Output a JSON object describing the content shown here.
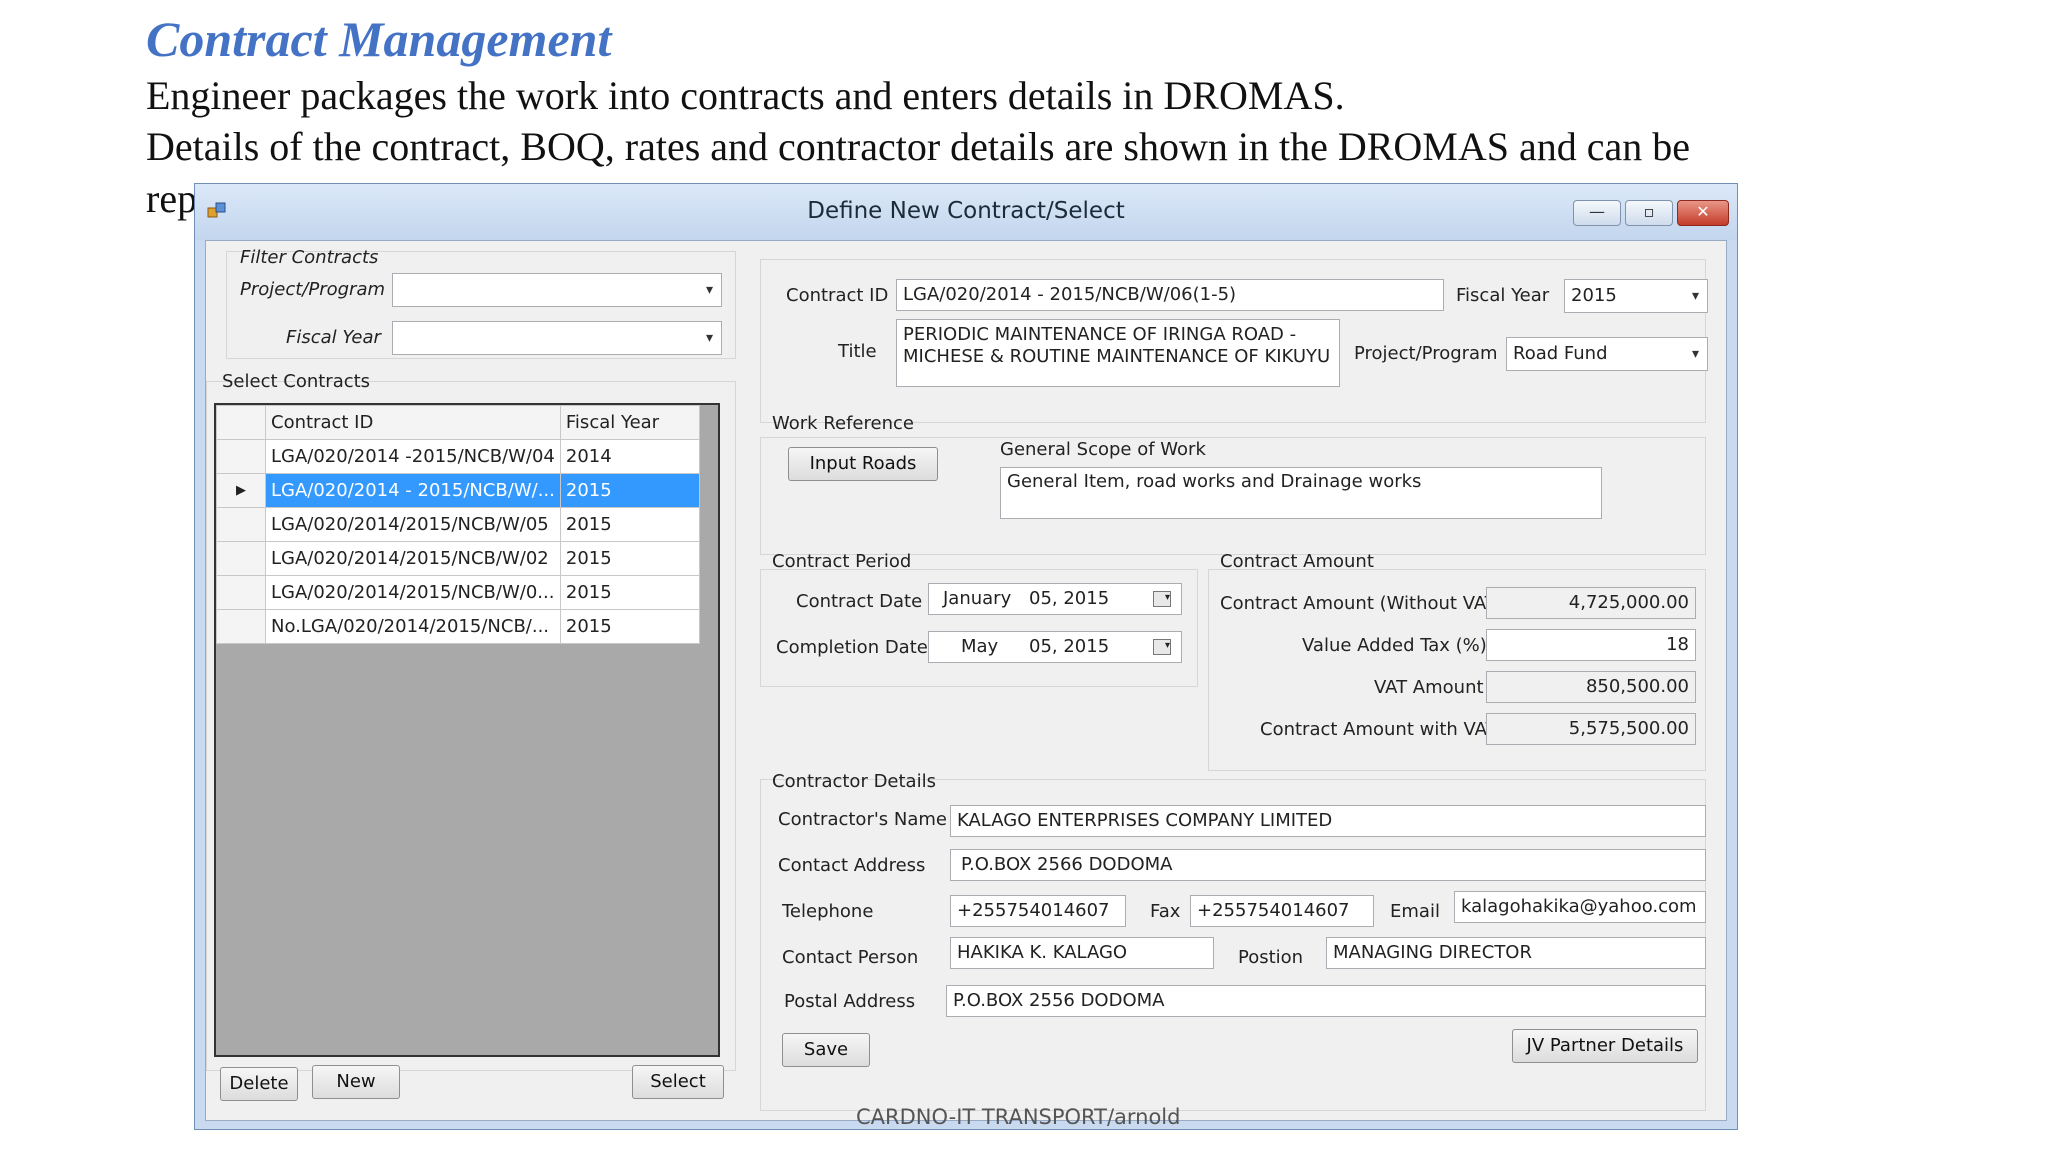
{
  "slide": {
    "title": "Contract Management",
    "line1": "Engineer packages the work into contracts and enters details in DROMAS.",
    "line2": "Details of the contract, BOQ, rates and contractor details are shown in the DROMAS and can be",
    "line3": "rep"
  },
  "window": {
    "title": "Define New Contract/Select",
    "controls": {
      "minimize": "—",
      "maximize": "▫",
      "close": "✕"
    }
  },
  "filter": {
    "group_label": "Filter Contracts",
    "project_label": "Project/Program",
    "project_value": "",
    "fiscal_label": "Fiscal Year",
    "fiscal_value": ""
  },
  "select_contracts": {
    "label": "Select Contracts",
    "columns": [
      "Contract ID",
      "Fiscal Year"
    ],
    "rows": [
      {
        "id": "LGA/020/2014 -2015/NCB/W/04",
        "year": "2014"
      },
      {
        "id": "LGA/020/2014 - 2015/NCB/W/...",
        "year": "2015"
      },
      {
        "id": "LGA/020/2014/2015/NCB/W/05",
        "year": "2015"
      },
      {
        "id": "LGA/020/2014/2015/NCB/W/02",
        "year": "2015"
      },
      {
        "id": "LGA/020/2014/2015/NCB/W/0...",
        "year": "2015"
      },
      {
        "id": "No.LGA/020/2014/2015/NCB/...",
        "year": "2015"
      }
    ],
    "selected_row_marker": "▶",
    "buttons": {
      "delete": "Delete",
      "new": "New",
      "select": "Select"
    }
  },
  "contract": {
    "id_label": "Contract ID",
    "id_value": "LGA/020/2014 - 2015/NCB/W/06(1-5)",
    "fiscal_label": "Fiscal Year",
    "fiscal_value": "2015",
    "title_label": "Title",
    "title_value": "PERIODIC MAINTENANCE OF IRINGA ROAD - MICHESE & ROUTINE MAINTENANCE OF KIKUYU",
    "project_label": "Project/Program",
    "project_value": "Road Fund"
  },
  "work_reference": {
    "label": "Work Reference",
    "input_roads_button": "Input Roads",
    "scope_label": "General Scope of Work",
    "scope_value": "General Item, road works and Drainage works"
  },
  "contract_period": {
    "label": "Contract Period",
    "contract_date_label": "Contract Date",
    "contract_date_month": "January",
    "contract_date_day": "05, 2015",
    "completion_date_label": "Completion Date",
    "completion_date_month": "May",
    "completion_date_day": "05, 2015"
  },
  "contract_amount": {
    "label": "Contract Amount",
    "without_vat_label": "Contract Amount (Without VAT)",
    "without_vat_value": "4,725,000.00",
    "vat_pct_label": "Value Added Tax (%)",
    "vat_pct_value": "18",
    "vat_amount_label": "VAT Amount",
    "vat_amount_value": "850,500.00",
    "with_vat_label": "Contract Amount with VAT",
    "with_vat_value": "5,575,500.00"
  },
  "contractor": {
    "label": "Contractor Details",
    "name_label": "Contractor's Name",
    "name_value": "KALAGO ENTERPRISES COMPANY LIMITED",
    "address_label": "Contact Address",
    "address_value": "P.O.BOX 2566 DODOMA",
    "telephone_label": "Telephone",
    "telephone_value": "+255754014607",
    "fax_label": "Fax",
    "fax_value": "+255754014607",
    "email_label": "Email",
    "email_value": "kalagohakika@yahoo.com",
    "person_label": "Contact Person",
    "person_value": "HAKIKA K. KALAGO",
    "position_label": "Postion",
    "position_value": "MANAGING DIRECTOR",
    "postal_label": "Postal Address",
    "postal_value": "P.O.BOX 2556 DODOMA",
    "save_button": "Save",
    "jv_button": "JV Partner Details"
  },
  "footer": "CARDNO-IT TRANSPORT/arnold",
  "icons": {
    "dropdown": "chevron-down-icon",
    "calendar": "calendar-icon",
    "app": "app-icon"
  },
  "colors": {
    "title_accent": "#4472c4",
    "selection": "#3399ff",
    "close_button": "#c43c2a"
  }
}
